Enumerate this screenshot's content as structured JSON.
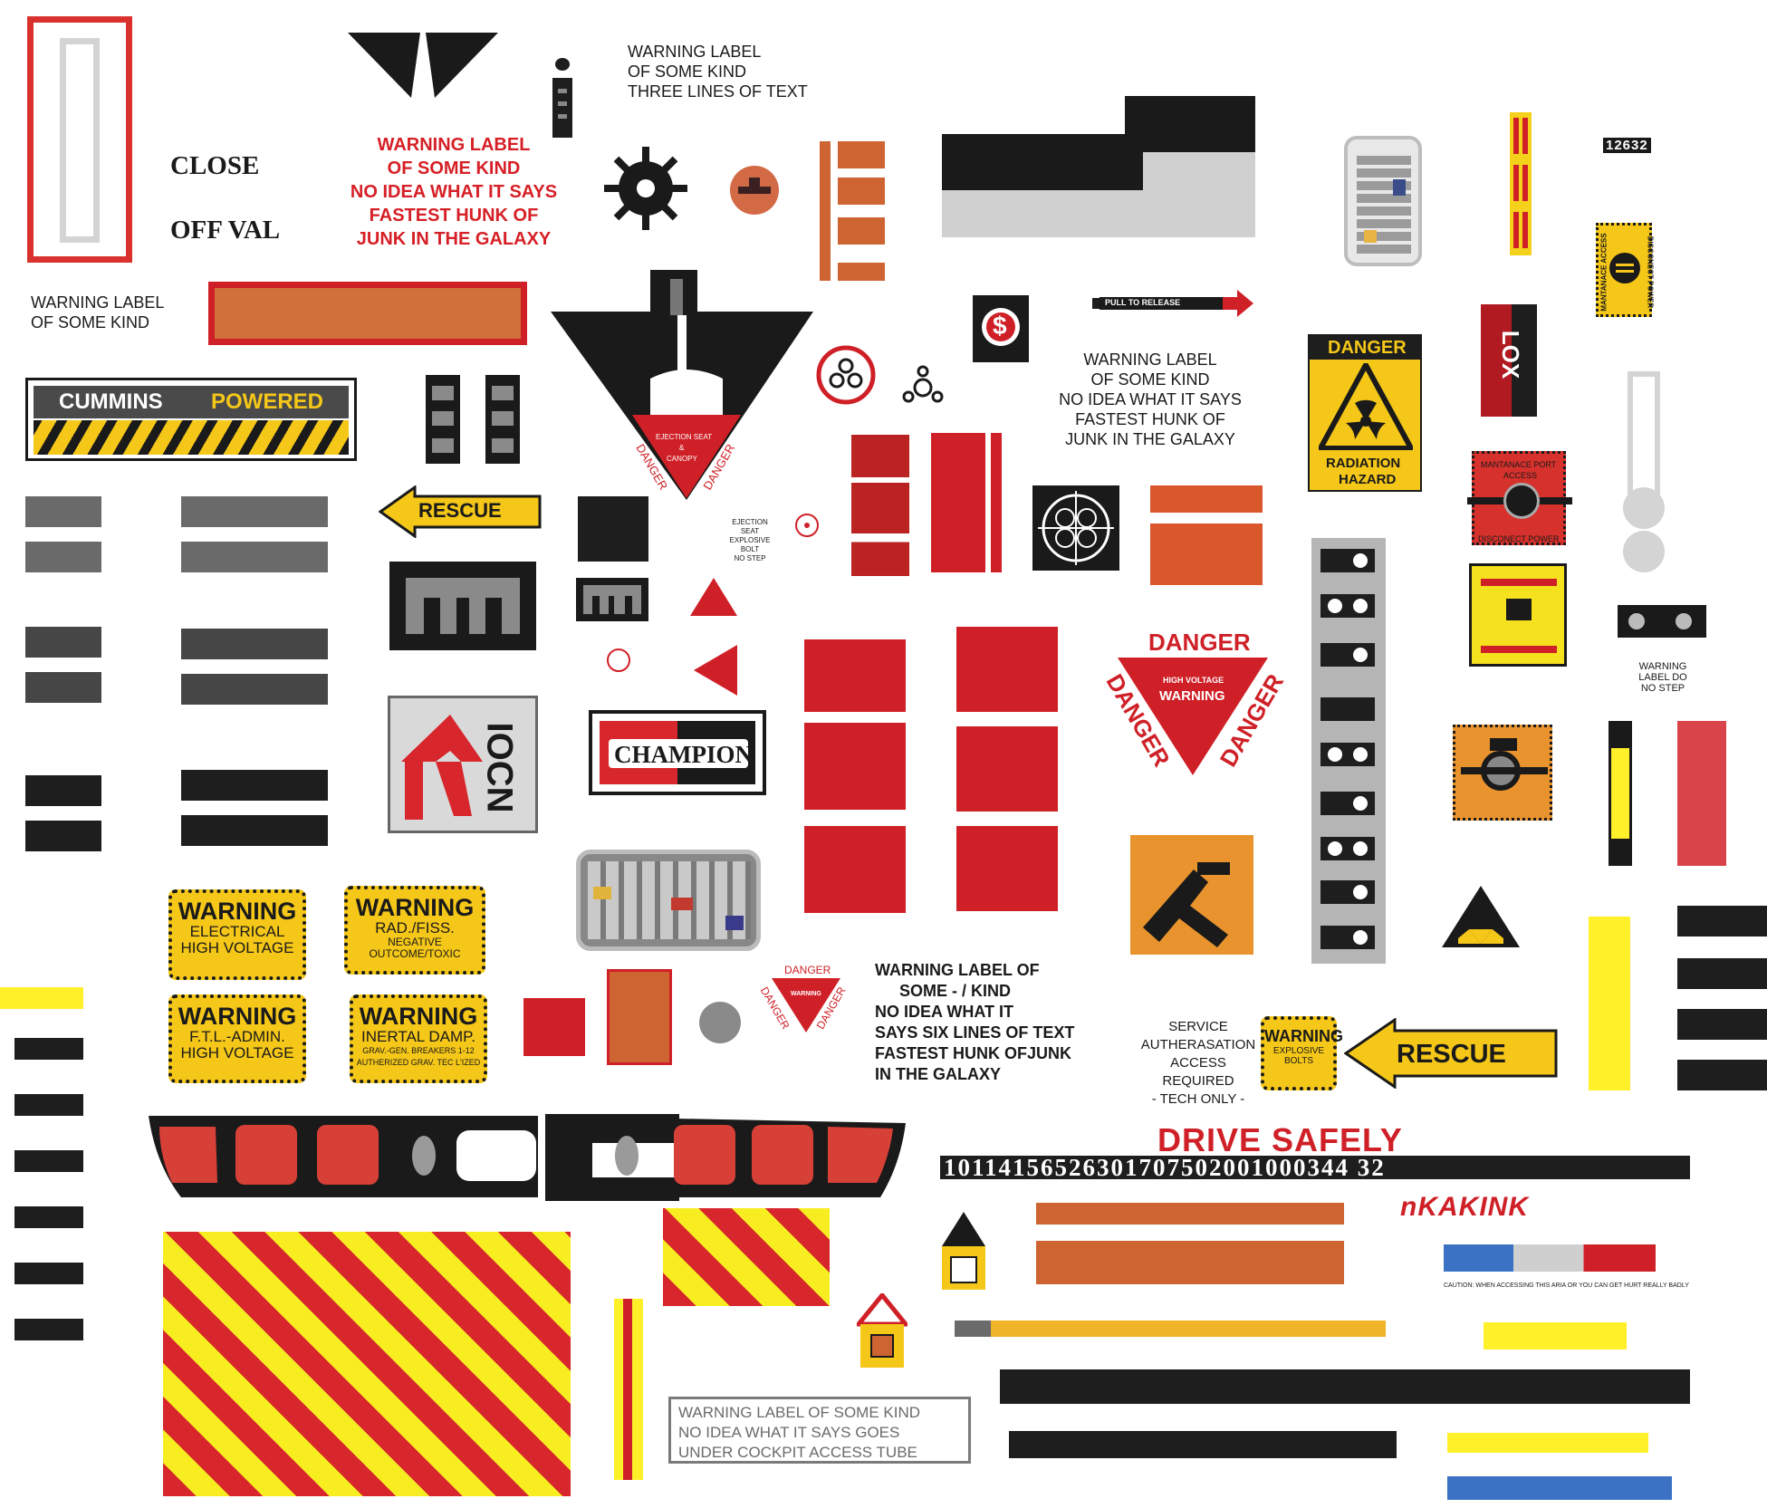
{
  "labels": {
    "close": "CLOSE",
    "off_val": "OFF VAL",
    "warning_three": [
      "WARNING LABEL",
      "OF SOME KIND",
      "THREE LINES OF TEXT"
    ],
    "warning_red": [
      "WARNING LABEL",
      "OF SOME KIND",
      "NO IDEA WHAT IT SAYS",
      "FASTEST HUNK OF",
      "JUNK IN THE GALAXY"
    ],
    "warning_two": [
      "WARNING LABEL",
      "OF SOME KIND"
    ],
    "cummins": "CUMMINS",
    "powered": "POWERED",
    "rescue_left": "RESCUE",
    "rescue_right": "RESCUE",
    "ejection_seat": "EJECTION SEAT",
    "ampersand": "&",
    "canopy": "CANOPY",
    "danger": "DANGER",
    "ejection_bolt": [
      "EJECTION SEAT",
      "EXPLOSIVE BOLT",
      "NO STEP"
    ],
    "pull_to_release": "PULL TO RELEASE",
    "warning_five": [
      "WARNING LABEL",
      "OF SOME KIND",
      "NO IDEA WHAT IT SAYS",
      "FASTEST HUNK OF",
      "JUNK IN THE GALAXY"
    ],
    "radiation_danger": "DANGER",
    "radiation_hazard": [
      "RADIATION",
      "HAZARD"
    ],
    "serial": "12632",
    "maint_access": "MANTANACE ACCESS",
    "disconnect_power": "DISCONECT POWER",
    "maint_port": [
      "MANTANACE PORT",
      "ACCESS"
    ],
    "disconect_power2": "DISCONECT POWER",
    "lox": "LOX",
    "champion": "CHAMPION",
    "iocn": "IOCN",
    "big_danger": "DANGER",
    "high_voltage": "HIGH VOLTAGE",
    "warning_word": "WARNING",
    "no_step": [
      "WARNING",
      "LABEL DO",
      "NO STEP"
    ],
    "warn_boxes": [
      {
        "title": "WARNING",
        "l1": "ELECTRICAL",
        "l2": "HIGH VOLTAGE"
      },
      {
        "title": "WARNING",
        "l1": "RAD./FISS.",
        "l2": "NEGATIVE",
        "l3": "OUTCOME/TOXIC"
      },
      {
        "title": "WARNING",
        "l1": "F.T.L.-ADMIN.",
        "l2": "HIGH VOLTAGE"
      },
      {
        "title": "WARNING",
        "l1": "INERTAL DAMP.",
        "l2": "GRAV.-GEN. BREAKERS 1-12",
        "l3": "AUTHERIZED GRAV. TEC L'IZED"
      }
    ],
    "warning_six": [
      "WARNING LABEL OF",
      "SOME - / KIND",
      "NO IDEA WHAT IT",
      "SAYS SIX LINES OF TEXT",
      "FASTEST HUNK OFJUNK",
      "IN THE GALAXY"
    ],
    "service": [
      "SERVICE",
      "AUTHERASATION",
      "ACCESS REQUIRED",
      "- TECH ONLY -"
    ],
    "warning_bolts": {
      "title": "WARNING",
      "sub": "EXPLOSIVE BOLTS"
    },
    "drive_safely": "DRIVE SAFELY",
    "number_strip": "10114156526301707502001000344 32",
    "brand": "nKAKINK",
    "caution": "CAUTION: WHEN ACCESSING THIS ARIA OR YOU CAN GET HURT REALLY BADLY",
    "cockpit": [
      "WARNING LABEL OF SOME KIND",
      "NO IDEA WHAT IT SAYS GOES",
      "UNDER COCKPIT ACCESS TUBE"
    ],
    "small_danger": "DANGER",
    "small_warning": "WARNING"
  },
  "colors": {
    "red": "#cf2027",
    "orange": "#cd6431",
    "yellow": "#f5c718",
    "black": "#1e1e1e",
    "grey": "#6a6a6a"
  }
}
